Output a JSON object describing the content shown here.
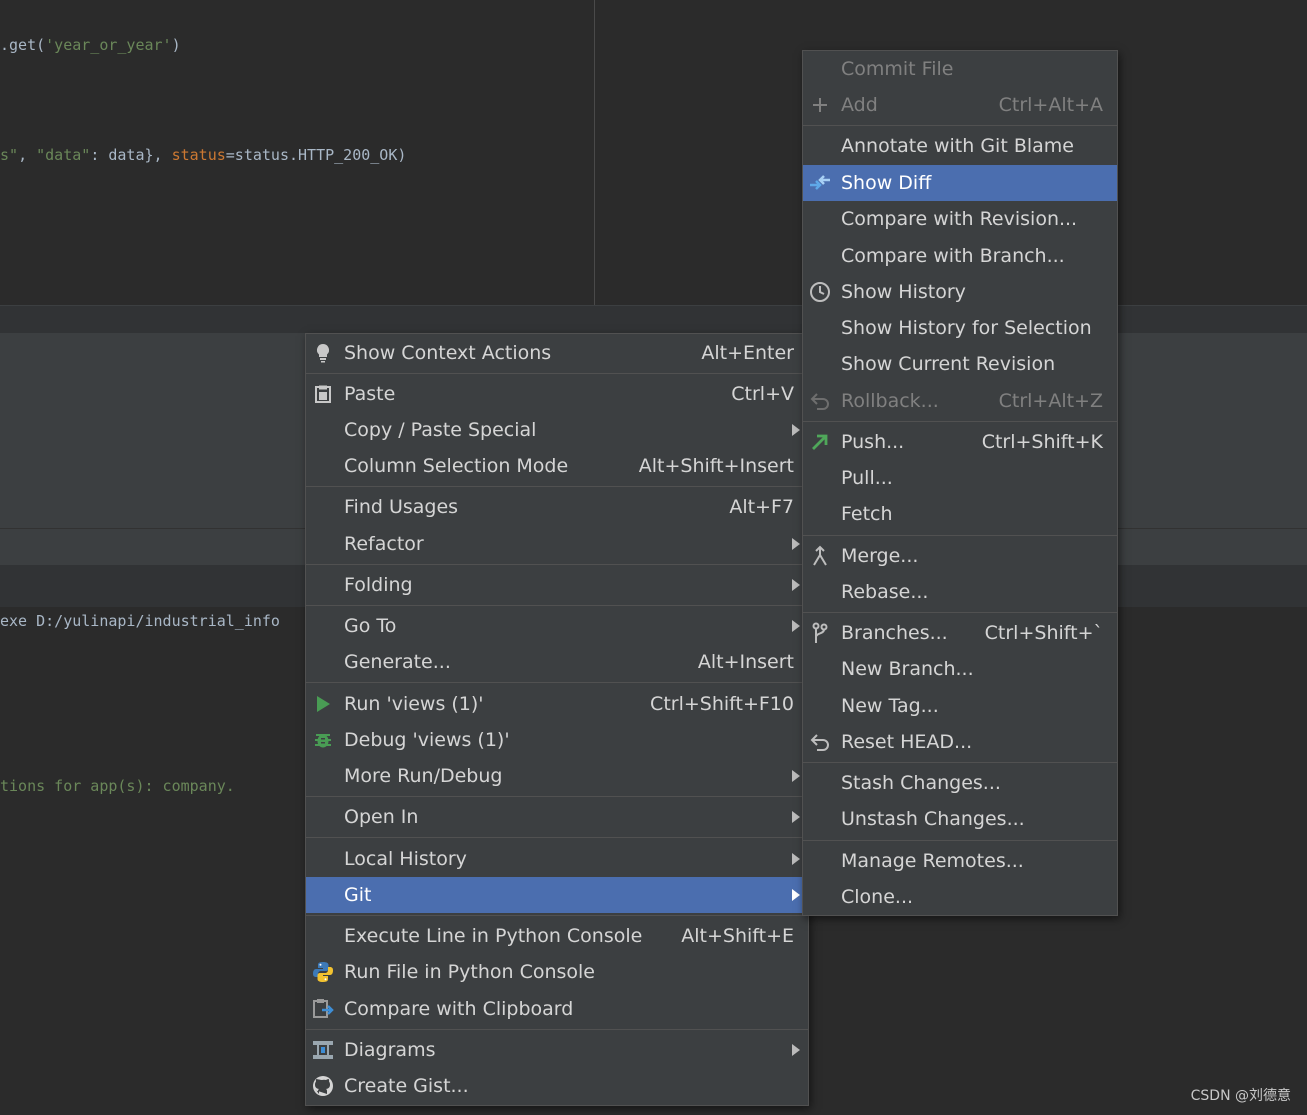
{
  "editor": {
    "line1_prefix": ".get(",
    "line1_string": "'year_or_year'",
    "line1_suffix": ")",
    "line2_a": "s\"",
    "line2_b": ", ",
    "line2_c": "\"data\"",
    "line2_d": ": data}, ",
    "line2_e": "status",
    "line2_f": "=status.HTTP_200_OK)"
  },
  "console": {
    "line1": "exe D:/yulinapi/industrial_info",
    "line2": "tions for app(s): company."
  },
  "context_menu": {
    "items": [
      {
        "label": "Show Context Actions",
        "shortcut": "Alt+Enter",
        "icon": "lightbulb-icon"
      },
      {
        "label": "Paste",
        "shortcut": "Ctrl+V",
        "icon": "clipboard-icon"
      },
      {
        "label": "Copy / Paste Special",
        "shortcut": ""
      },
      {
        "label": "Column Selection Mode",
        "shortcut": "Alt+Shift+Insert"
      },
      {
        "label": "Find Usages",
        "shortcut": "Alt+F7"
      },
      {
        "label": "Refactor",
        "shortcut": ""
      },
      {
        "label": "Folding",
        "shortcut": ""
      },
      {
        "label": "Go To",
        "shortcut": ""
      },
      {
        "label": "Generate...",
        "shortcut": "Alt+Insert"
      },
      {
        "label": "Run 'views (1)'",
        "shortcut": "Ctrl+Shift+F10",
        "icon": "run-icon"
      },
      {
        "label": "Debug 'views (1)'",
        "shortcut": "",
        "icon": "debug-icon"
      },
      {
        "label": "More Run/Debug",
        "shortcut": ""
      },
      {
        "label": "Open In",
        "shortcut": ""
      },
      {
        "label": "Local History",
        "shortcut": ""
      },
      {
        "label": "Git",
        "shortcut": ""
      },
      {
        "label": "Execute Line in Python Console",
        "shortcut": "Alt+Shift+E"
      },
      {
        "label": "Run File in Python Console",
        "shortcut": "",
        "icon": "python-icon"
      },
      {
        "label": "Compare with Clipboard",
        "shortcut": "",
        "icon": "compare-clipboard-icon"
      },
      {
        "label": "Diagrams",
        "shortcut": "",
        "icon": "diagram-icon"
      },
      {
        "label": "Create Gist...",
        "shortcut": "",
        "icon": "github-icon"
      }
    ]
  },
  "git_menu": {
    "items": [
      {
        "label": "Commit File",
        "shortcut": ""
      },
      {
        "label": "Add",
        "shortcut": "Ctrl+Alt+A",
        "icon": "plus-icon"
      },
      {
        "label": "Annotate with Git Blame",
        "shortcut": ""
      },
      {
        "label": "Show Diff",
        "shortcut": "",
        "icon": "diff-icon"
      },
      {
        "label": "Compare with Revision...",
        "shortcut": ""
      },
      {
        "label": "Compare with Branch...",
        "shortcut": ""
      },
      {
        "label": "Show History",
        "shortcut": "",
        "icon": "clock-icon"
      },
      {
        "label": "Show History for Selection",
        "shortcut": ""
      },
      {
        "label": "Show Current Revision",
        "shortcut": ""
      },
      {
        "label": "Rollback...",
        "shortcut": "Ctrl+Alt+Z",
        "icon": "undo-icon"
      },
      {
        "label": "Push...",
        "shortcut": "Ctrl+Shift+K",
        "icon": "push-arrow-icon"
      },
      {
        "label": "Pull...",
        "shortcut": ""
      },
      {
        "label": "Fetch",
        "shortcut": ""
      },
      {
        "label": "Merge...",
        "shortcut": "",
        "icon": "merge-icon"
      },
      {
        "label": "Rebase...",
        "shortcut": ""
      },
      {
        "label": "Branches...",
        "shortcut": "Ctrl+Shift+`",
        "icon": "branch-icon"
      },
      {
        "label": "New Branch...",
        "shortcut": ""
      },
      {
        "label": "New Tag...",
        "shortcut": ""
      },
      {
        "label": "Reset HEAD...",
        "shortcut": "",
        "icon": "reset-icon"
      },
      {
        "label": "Stash Changes...",
        "shortcut": ""
      },
      {
        "label": "Unstash Changes...",
        "shortcut": ""
      },
      {
        "label": "Manage Remotes...",
        "shortcut": ""
      },
      {
        "label": "Clone...",
        "shortcut": ""
      }
    ]
  },
  "watermark": "CSDN @刘德意",
  "colors": {
    "selection": "#4b6eaf",
    "menu_bg": "#3c3f41",
    "run_green": "#499c54"
  }
}
